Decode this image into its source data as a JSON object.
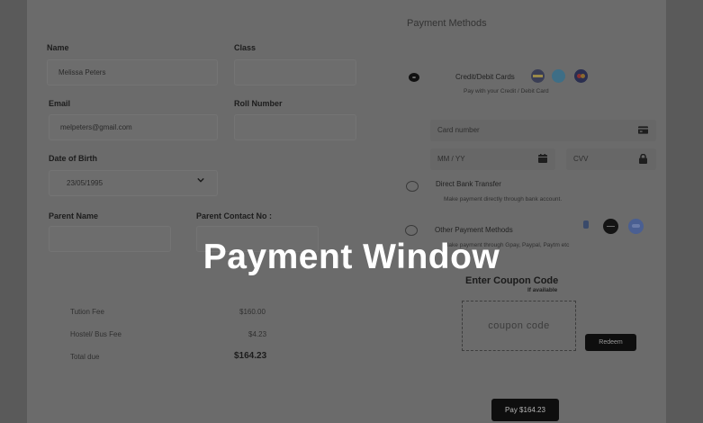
{
  "overlay": {
    "title": "Payment Window"
  },
  "student": {
    "name_label": "Name",
    "name_value": "Melissa Peters",
    "class_label": "Class",
    "class_value": "",
    "email_label": "Email",
    "email_value": "melpeters@gmail.com",
    "roll_label": "Roll Number",
    "roll_value": "",
    "dob_label": "Date of Birth",
    "dob_value": "23/05/1995",
    "parent_name_label": "Parent Name",
    "parent_name_value": "",
    "parent_contact_label": "Parent Contact No :",
    "parent_contact_value": ""
  },
  "fees": {
    "tuition_label": "Tution Fee",
    "tuition_value": "$160.00",
    "hostel_label": "Hostel/ Bus Fee",
    "hostel_value": "$4.23",
    "total_label": "Total due",
    "total_value": "$164.23"
  },
  "payment": {
    "title": "Payment Methods",
    "card_title": "Credit/Debit Cards",
    "card_sub": "Pay with your Credit / Debit Card",
    "card_number_placeholder": "Card number",
    "expiry_placeholder": "MM / YY",
    "cvv_placeholder": "CVV",
    "bank_title": "Direct Bank Transfer",
    "bank_sub": "Make payment directly through bank account.",
    "other_title": "Other Payment Methods",
    "other_sub": "Make payment through Gpay, Paypal, Paytm etc",
    "card_logos": [
      "visa-logo",
      "amex-logo",
      "mastercard-logo"
    ],
    "other_logos": [
      "paypal-logo",
      "amazon-pay-logo",
      "gpay-logo"
    ]
  },
  "coupon": {
    "title": "Enter Coupon Code",
    "subtitle": "If available",
    "placeholder": "coupon code",
    "redeem_label": "Redeem"
  },
  "pay_button_label": "Pay  $164.23",
  "colors": {
    "background_dim": "#5a5a5a",
    "card": "#6b6b6b",
    "button": "#0e0e0e"
  }
}
